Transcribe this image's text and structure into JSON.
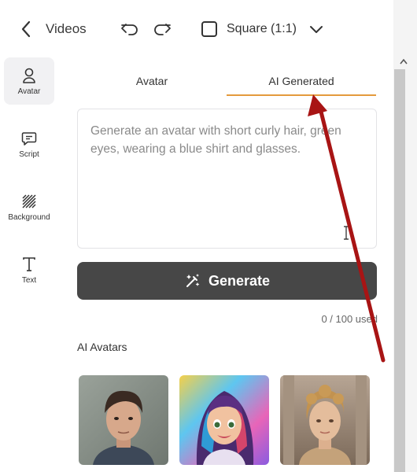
{
  "header": {
    "title": "Videos",
    "aspect_ratio": "Square (1:1)"
  },
  "sidebar": {
    "items": [
      {
        "label": "Avatar",
        "icon": "person-icon",
        "active": true
      },
      {
        "label": "Script",
        "icon": "chat-icon",
        "active": false
      },
      {
        "label": "Background",
        "icon": "hatch-icon",
        "active": false
      },
      {
        "label": "Text",
        "icon": "text-icon",
        "active": false
      }
    ]
  },
  "tabs": [
    {
      "label": "Avatar",
      "active": false
    },
    {
      "label": "AI Generated",
      "active": true
    }
  ],
  "prompt": {
    "placeholder": "Generate an avatar with short curly hair, green eyes, wearing a blue shirt and glasses."
  },
  "generate": {
    "label": "Generate",
    "usage": "0 / 100 used"
  },
  "ai_avatars": {
    "title": "AI Avatars",
    "items": [
      {
        "icon": "young-man-portrait"
      },
      {
        "icon": "cartoon-girl-portrait"
      },
      {
        "icon": "classical-woman-portrait"
      }
    ]
  },
  "colors": {
    "accent": "#e49a3d",
    "button": "#474747",
    "annotation_arrow": "#a81414"
  }
}
